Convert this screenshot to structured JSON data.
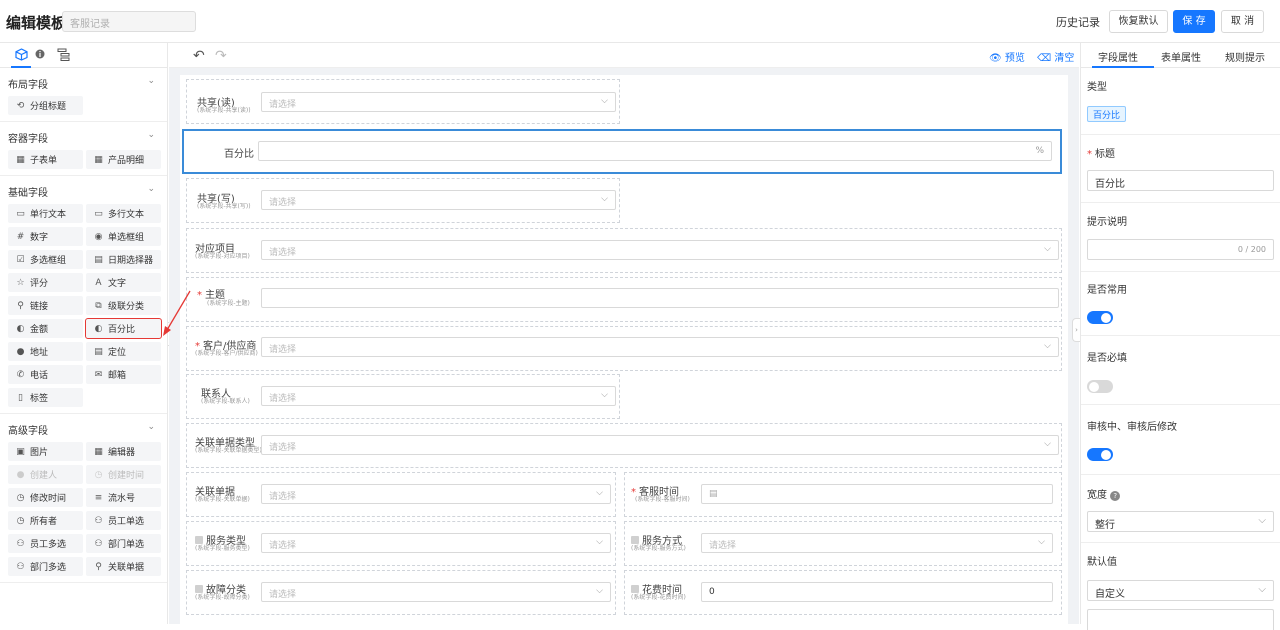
{
  "header": {
    "title": "编辑模板",
    "template_name_placeholder": "客服记录",
    "history": "历史记录",
    "restore_default": "恢复默认",
    "save": "保 存",
    "cancel": "取 消"
  },
  "left_panel": {
    "groups": [
      {
        "title": "布局字段",
        "items": [
          {
            "label": "分组标题",
            "icon": "group-title-icon",
            "glyph": "⟲"
          }
        ]
      },
      {
        "title": "容器字段",
        "items": [
          {
            "label": "子表单",
            "icon": "table-icon",
            "glyph": "▦"
          },
          {
            "label": "产品明细",
            "icon": "table-icon",
            "glyph": "▦"
          }
        ]
      },
      {
        "title": "基础字段",
        "items": [
          {
            "label": "单行文本",
            "icon": "single-line-icon",
            "glyph": "▭"
          },
          {
            "label": "多行文本",
            "icon": "multi-line-icon",
            "glyph": "▭"
          },
          {
            "label": "数字",
            "icon": "number-icon",
            "glyph": "#"
          },
          {
            "label": "单选框组",
            "icon": "radio-icon",
            "glyph": "◉"
          },
          {
            "label": "多选框组",
            "icon": "checkbox-icon",
            "glyph": "☑"
          },
          {
            "label": "日期选择器",
            "icon": "calendar-icon",
            "glyph": "▤"
          },
          {
            "label": "评分",
            "icon": "star-icon",
            "glyph": "☆"
          },
          {
            "label": "文字",
            "icon": "text-icon",
            "glyph": "A"
          },
          {
            "label": "链接",
            "icon": "link-icon",
            "glyph": "⚲"
          },
          {
            "label": "级联分类",
            "icon": "cascade-icon",
            "glyph": "⧉"
          },
          {
            "label": "金额",
            "icon": "amount-icon",
            "glyph": "◐"
          },
          {
            "label": "百分比",
            "icon": "percent-icon",
            "glyph": "◐"
          },
          {
            "label": "地址",
            "icon": "location-icon",
            "glyph": "●"
          },
          {
            "label": "定位",
            "icon": "position-icon",
            "glyph": "▤"
          },
          {
            "label": "电话",
            "icon": "phone-icon",
            "glyph": "✆"
          },
          {
            "label": "邮箱",
            "icon": "mail-icon",
            "glyph": "✉"
          },
          {
            "label": "标签",
            "icon": "tag-icon",
            "glyph": "▯"
          }
        ]
      },
      {
        "title": "高级字段",
        "items": [
          {
            "label": "图片",
            "icon": "image-icon",
            "glyph": "▣"
          },
          {
            "label": "编辑器",
            "icon": "editor-icon",
            "glyph": "▦"
          },
          {
            "label": "创建人",
            "icon": "user-icon",
            "glyph": "●"
          },
          {
            "label": "创建时间",
            "icon": "clock-icon",
            "glyph": "◷"
          },
          {
            "label": "修改时间",
            "icon": "clock-icon",
            "glyph": "◷"
          },
          {
            "label": "流水号",
            "icon": "serial-icon",
            "glyph": "≡"
          },
          {
            "label": "所有者",
            "icon": "clock-icon",
            "glyph": "◷"
          },
          {
            "label": "员工单选",
            "icon": "users-icon",
            "glyph": "⚇"
          },
          {
            "label": "员工多选",
            "icon": "users-icon",
            "glyph": "⚇"
          },
          {
            "label": "部门单选",
            "icon": "users-icon",
            "glyph": "⚇"
          },
          {
            "label": "部门多选",
            "icon": "users-icon",
            "glyph": "⚇"
          },
          {
            "label": "关联单据",
            "icon": "link-icon",
            "glyph": "⚲"
          }
        ]
      }
    ]
  },
  "toolbar": {
    "preview": "预览",
    "clear": "清空"
  },
  "form": {
    "select_placeholder": "请选择",
    "fields": [
      {
        "label": "共享(读)",
        "sub": "(系统字段-共享(读))"
      },
      {
        "label": "百分比",
        "sub": "",
        "suffix": "%"
      },
      {
        "label": "共享(写)",
        "sub": "(系统字段-共享(写))"
      },
      {
        "label": "对应项目",
        "sub": "(系统字段-对应项目)"
      },
      {
        "label": "主题",
        "sub": "(系统字段-主题)"
      },
      {
        "label": "客户/供应商",
        "sub": "(系统字段-客户/供应商)"
      },
      {
        "label": "联系人",
        "sub": "(系统字段-联系人)"
      },
      {
        "label": "关联单据类型",
        "sub": "(系统字段-关联单据类型)"
      },
      {
        "label": "关联单据",
        "sub": "(系统字段-关联单据)"
      },
      {
        "label": "客服时间",
        "sub": "(系统字段-客服时间)"
      },
      {
        "label": "服务类型",
        "sub": "(系统字段-服务类型)"
      },
      {
        "label": "服务方式",
        "sub": "(系统字段-服务方式)"
      },
      {
        "label": "故障分类",
        "sub": "(系统字段-故障分类)"
      },
      {
        "label": "花费时间",
        "sub": "(系统字段-花费时间)",
        "value": "0"
      }
    ]
  },
  "right_panel": {
    "tabs": [
      "字段属性",
      "表单属性",
      "规则提示"
    ],
    "type_label": "类型",
    "type_value": "百分比",
    "title_label": "标题",
    "title_value": "百分比",
    "hint_label": "提示说明",
    "hint_count": "0 / 200",
    "common_label": "是否常用",
    "common_on": true,
    "required_label": "是否必填",
    "required_on": false,
    "audit_label": "审核中、审核后修改",
    "audit_on": true,
    "width_label": "宽度",
    "width_value": "整行",
    "default_label": "默认值",
    "default_value": "自定义"
  },
  "colors": {
    "accent": "#1677ff",
    "highlight": "#e53935",
    "selected_border": "#3a8bd8"
  }
}
